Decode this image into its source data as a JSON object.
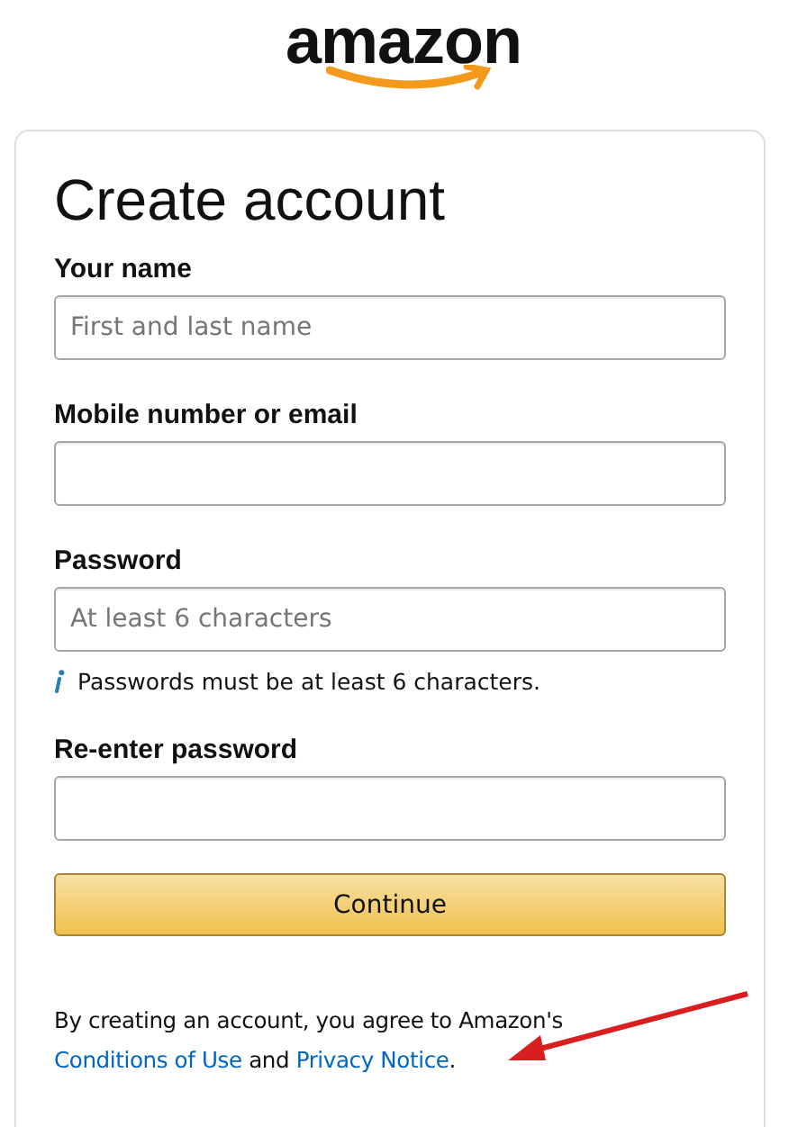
{
  "logo": {
    "text": "amazon"
  },
  "form": {
    "title": "Create account",
    "fields": [
      {
        "label": "Your name",
        "placeholder": "First and last name"
      },
      {
        "label": "Mobile number or email"
      },
      {
        "label": "Password",
        "placeholder": "At least 6 characters",
        "hint": "Passwords must be at least 6 characters."
      },
      {
        "label": "Re-enter password"
      }
    ],
    "submit": "Continue",
    "legal": {
      "text": "By creating an account, you agree to Amazon's",
      "link_1": "Conditions of Use",
      "joiner": "and",
      "link_2": "Privacy Notice",
      "end": "."
    }
  }
}
